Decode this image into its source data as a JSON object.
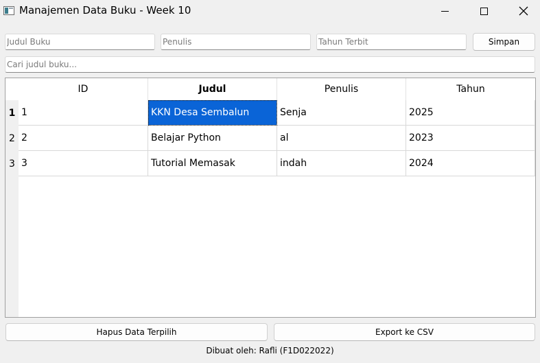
{
  "window": {
    "title": "Manajemen Data Buku - Week 10",
    "icon": "app-window-icon",
    "controls": [
      "minimize-icon",
      "maximize-icon",
      "close-icon"
    ]
  },
  "form": {
    "judul_placeholder": "Judul Buku",
    "judul_value": "",
    "penulis_placeholder": "Penulis",
    "penulis_value": "",
    "tahun_placeholder": "Tahun Terbit",
    "tahun_value": "",
    "simpan_label": "Simpan"
  },
  "search": {
    "placeholder": "Cari judul buku...",
    "value": ""
  },
  "table": {
    "headers": [
      "ID",
      "Judul",
      "Penulis",
      "Tahun"
    ],
    "rows": [
      {
        "row_label": "1",
        "id": "1",
        "judul": "KKN Desa Sembalun",
        "penulis": "Senja",
        "tahun": "2025"
      },
      {
        "row_label": "2",
        "id": "2",
        "judul": "Belajar Python",
        "penulis": "al",
        "tahun": "2023"
      },
      {
        "row_label": "3",
        "id": "3",
        "judul": "Tutorial Memasak",
        "penulis": "indah",
        "tahun": "2024"
      }
    ],
    "selected": {
      "row": 1,
      "column": "Judul"
    },
    "selection_color": "#0a64d7"
  },
  "actions": {
    "hapus_label": "Hapus Data Terpilih",
    "export_label": "Export ke CSV"
  },
  "footer": {
    "credit": "Dibuat oleh: Rafli (F1D022022)"
  }
}
